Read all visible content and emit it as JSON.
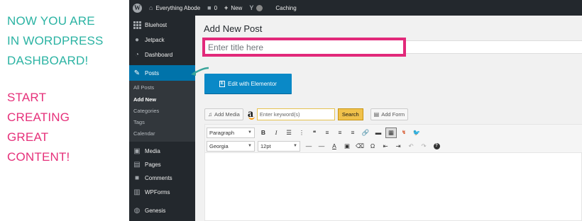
{
  "caption": {
    "lines_top": [
      "NOW YOU ARE",
      "IN WORDPRESS",
      "DASHBOARD!"
    ],
    "lines_bottom": [
      "START",
      "CREATING",
      "GREAT",
      "CONTENT!"
    ],
    "colors": {
      "top": "#2bb3a3",
      "bottom": "#e6307a"
    }
  },
  "adminbar": {
    "site_name": "Everything Abode",
    "comments_count": "0",
    "new_label": "New",
    "caching_label": "Caching",
    "icons": [
      "wordpress-logo-icon",
      "home-icon",
      "comment-icon",
      "plus-icon",
      "yoast-icon",
      "status-dot-icon"
    ]
  },
  "sidebar": {
    "items": [
      {
        "label": "Bluehost",
        "icon": "grid-icon"
      },
      {
        "label": "Jetpack",
        "icon": "jetpack-icon"
      },
      {
        "label": "Dashboard",
        "icon": "dashboard-icon"
      },
      {
        "label": "Posts",
        "icon": "pin-icon",
        "active": true
      },
      {
        "label": "Media",
        "icon": "media-icon"
      },
      {
        "label": "Pages",
        "icon": "pages-icon"
      },
      {
        "label": "Comments",
        "icon": "comments-icon"
      },
      {
        "label": "WPForms",
        "icon": "forms-icon"
      },
      {
        "label": "Genesis",
        "icon": "genesis-icon"
      }
    ],
    "submenu": [
      {
        "label": "All Posts"
      },
      {
        "label": "Add New",
        "current": true
      },
      {
        "label": "Categories"
      },
      {
        "label": "Tags"
      },
      {
        "label": "Calendar"
      }
    ],
    "active_color": "#0073aa"
  },
  "editor_page": {
    "title": "Add New Post",
    "title_placeholder": "Enter title here",
    "highlight_color": "#e2297a",
    "elementor_label": "Edit with Elementor",
    "add_media_label": "Add Media",
    "amazon_glyph": "a",
    "keyword_placeholder": "Enter keyword(s)",
    "search_label": "Search",
    "add_form_label": "Add Form",
    "toolbar": {
      "format_select": "Paragraph",
      "font_select": "Georgia",
      "size_select": "12pt",
      "row1_buttons": [
        "B",
        "I",
        "☰",
        "⋮",
        "❝",
        "≡",
        "≡",
        "≡",
        "🔗",
        "▬",
        "▦",
        "↯",
        "🐦"
      ],
      "row2_buttons": [
        "—",
        "—",
        "A",
        "▣",
        "⌫",
        "Ω",
        "⇤",
        "⇥",
        "↶",
        "↷",
        "?"
      ]
    }
  }
}
